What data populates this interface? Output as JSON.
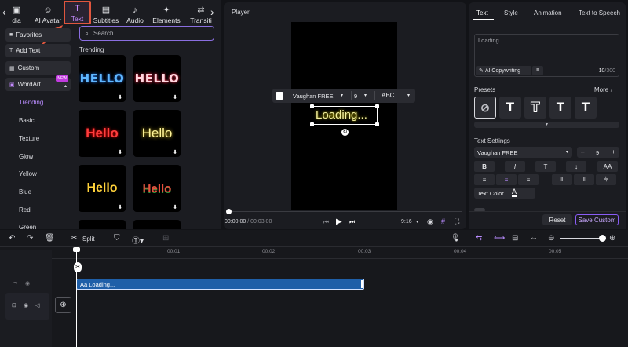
{
  "toolbar": {
    "items": [
      {
        "label": "dia",
        "icon": "media-icon"
      },
      {
        "label": "AI Avatar",
        "icon": "avatar-icon"
      },
      {
        "label": "Text",
        "icon": "text-icon"
      },
      {
        "label": "Subtitles",
        "icon": "subtitles-icon"
      },
      {
        "label": "Audio",
        "icon": "audio-icon"
      },
      {
        "label": "Elements",
        "icon": "elements-icon"
      },
      {
        "label": "Transiti",
        "icon": "transition-icon"
      }
    ]
  },
  "sidebar": {
    "favorites": "Favorites",
    "add_text": "Add Text",
    "custom": "Custom",
    "wordart": "WordArt",
    "new_badge": "NEW",
    "sub_items": [
      "Trending",
      "Basic",
      "Texture",
      "Glow",
      "Yellow",
      "Blue",
      "Red",
      "Green"
    ]
  },
  "library": {
    "search_placeholder": "Search",
    "section_title": "Trending",
    "thumbs": [
      "HELLO",
      "HELLO",
      "Hello",
      "Hello",
      "Hello",
      "Hello"
    ]
  },
  "player": {
    "title": "Player",
    "font": "Vaughan FREE",
    "size": "9",
    "case": "ABC",
    "overlay_text": "Loading...",
    "time_current": "00:00:00",
    "time_total": "/ 00:03:00",
    "ratio": "9:16"
  },
  "right_panel": {
    "tabs": [
      "Text",
      "Style",
      "Animation",
      "Text to Speech"
    ],
    "text_value": "Loading...",
    "ai_copywriting": "AI Copywriting",
    "char_count": "10",
    "char_max": "/300",
    "presets_label": "Presets",
    "more_label": "More",
    "text_settings_label": "Text Settings",
    "font": "Vaughan FREE",
    "size": "9",
    "text_color_label": "Text Color",
    "reset_label": "Reset",
    "save_custom_label": "Save Custom"
  },
  "timeline": {
    "split_label": "Split",
    "ticks": [
      "00:01",
      "00:02",
      "00:03",
      "00:04",
      "00:05"
    ],
    "clip_label": "Aa Loading..."
  },
  "colors": {
    "accent": "#8a5cf6",
    "highlight_box": "#e0563e",
    "clip_blue": "#1f5fa8"
  }
}
